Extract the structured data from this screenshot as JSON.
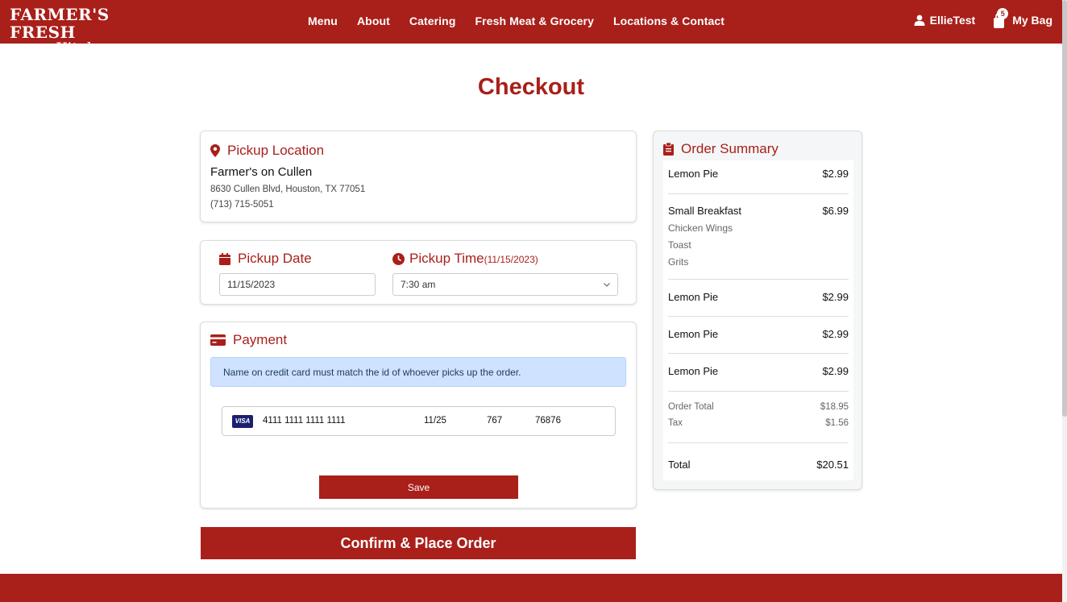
{
  "brand": {
    "line1": "FARMER'S FRESH",
    "line2": "Kitchen"
  },
  "nav": {
    "links": [
      "Menu",
      "About",
      "Catering",
      "Fresh Meat & Grocery",
      "Locations & Contact"
    ],
    "user": "EllieTest",
    "bag_label": "My Bag",
    "bag_count": "5"
  },
  "page": {
    "title": "Checkout"
  },
  "pickup_location": {
    "heading": "Pickup Location",
    "name": "Farmer's on Cullen",
    "address": "8630 Cullen Blvd, Houston, TX 77051",
    "phone": "(713) 715-5051"
  },
  "pickup_date": {
    "heading": "Pickup Date",
    "value": "11/15/2023"
  },
  "pickup_time": {
    "heading": "Pickup Time",
    "date_note": "(11/15/2023)",
    "value": "7:30 am"
  },
  "payment": {
    "heading": "Payment",
    "notice": "Name on credit card must match the id of whoever picks up the order.",
    "card": {
      "brand": "VISA",
      "number": "4111 1111 1111 1111",
      "expiry": "11/25",
      "cvv": "767",
      "zip": "76876"
    },
    "save_label": "Save"
  },
  "confirm_label": "Confirm & Place Order",
  "order_summary": {
    "heading": "Order Summary",
    "items": [
      {
        "name": "Lemon Pie",
        "price": "$2.99",
        "options": []
      },
      {
        "name": "Small Breakfast",
        "price": "$6.99",
        "options": [
          "Chicken Wings",
          "Toast",
          "Grits"
        ]
      },
      {
        "name": "Lemon Pie",
        "price": "$2.99",
        "options": []
      },
      {
        "name": "Lemon Pie",
        "price": "$2.99",
        "options": []
      },
      {
        "name": "Lemon Pie",
        "price": "$2.99",
        "options": []
      }
    ],
    "order_total_label": "Order Total",
    "order_total": "$18.95",
    "tax_label": "Tax",
    "tax": "$1.56",
    "total_label": "Total",
    "total": "$20.51"
  },
  "colors": {
    "brand": "#a91f1a",
    "alert_bg": "#cfe2ff"
  }
}
